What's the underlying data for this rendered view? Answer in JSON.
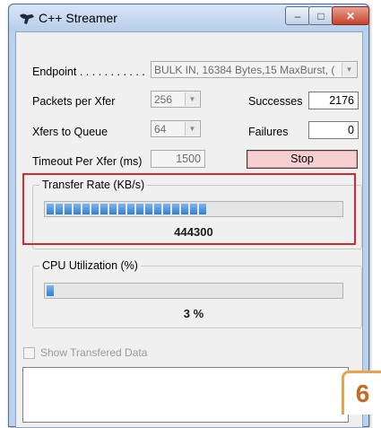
{
  "window": {
    "title": "C++ Streamer",
    "minimize_glyph": "–",
    "maximize_glyph": "□",
    "close_glyph": "✕"
  },
  "endpoint": {
    "label": "Endpoint . . . . . . . . . . .",
    "value": "BULK IN,      16384 Bytes,15 MaxBurst,  ("
  },
  "packets_per_xfer": {
    "label": "Packets per Xfer",
    "value": "256"
  },
  "xfers_to_queue": {
    "label": "Xfers to Queue",
    "value": "64"
  },
  "timeout": {
    "label": "Timeout Per Xfer (ms)",
    "value": "1500"
  },
  "successes": {
    "label": "Successes",
    "value": "2176"
  },
  "failures": {
    "label": "Failures",
    "value": "0"
  },
  "stop_button": {
    "label": "Stop"
  },
  "transfer_rate": {
    "title": "Transfer Rate (KB/s)",
    "value": "444300",
    "progress_fraction": 0.56
  },
  "cpu_utilization": {
    "title": "CPU Utilization (%)",
    "value": "3 %",
    "progress_fraction": 0.03
  },
  "show_data": {
    "label": "Show Transfered Data",
    "checked": false
  },
  "step_badge": {
    "number": "6"
  },
  "colors": {
    "highlight": "#d6292e",
    "badge": "#e8a44a",
    "progress": "#2f7fd0",
    "stop_button": "#f6cfd0"
  }
}
